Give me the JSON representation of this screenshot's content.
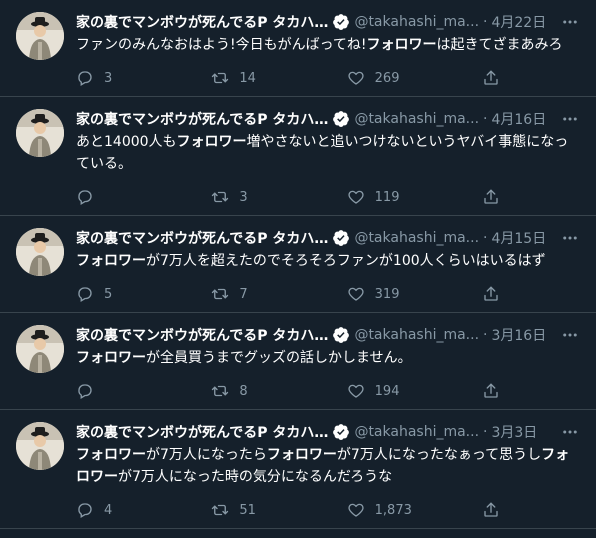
{
  "tweets": [
    {
      "name": "家の裏でマンボウが死んでるP タカハ…",
      "handle": "@takahashi_ma...",
      "date": "4月22日",
      "text_segments": [
        {
          "t": "ファンのみんなおはよう!今日もがんばってね!",
          "b": false
        },
        {
          "t": "フォロワー",
          "b": true
        },
        {
          "t": "は起きてざまあみろ",
          "b": false
        }
      ],
      "replies": "3",
      "retweets": "14",
      "likes": "269"
    },
    {
      "name": "家の裏でマンボウが死んでるP タカハ…",
      "handle": "@takahashi_ma...",
      "date": "4月16日",
      "text_segments": [
        {
          "t": "あと14000人も",
          "b": false
        },
        {
          "t": "フォロワー",
          "b": true
        },
        {
          "t": "増やさないと追いつけないというヤバイ事態になっている。",
          "b": false
        }
      ],
      "replies": "",
      "retweets": "3",
      "likes": "119"
    },
    {
      "name": "家の裏でマンボウが死んでるP タカハ…",
      "handle": "@takahashi_ma...",
      "date": "4月15日",
      "text_segments": [
        {
          "t": "フォロワー",
          "b": true
        },
        {
          "t": "が7万人を超えたのでそろそろファンが100人くらいはいるはず",
          "b": false
        }
      ],
      "replies": "5",
      "retweets": "7",
      "likes": "319"
    },
    {
      "name": "家の裏でマンボウが死んでるP タカハ…",
      "handle": "@takahashi_ma...",
      "date": "3月16日",
      "text_segments": [
        {
          "t": "フォロワー",
          "b": true
        },
        {
          "t": "が全員買うまでグッズの話しかしません。",
          "b": false
        }
      ],
      "replies": "",
      "retweets": "8",
      "likes": "194"
    },
    {
      "name": "家の裏でマンボウが死んでるP タカハ…",
      "handle": "@takahashi_ma...",
      "date": "3月3日",
      "text_segments": [
        {
          "t": "フォロワー",
          "b": true
        },
        {
          "t": "が7万人になったら",
          "b": false
        },
        {
          "t": "フォロワー",
          "b": true
        },
        {
          "t": "が7万人になったなぁって思うし",
          "b": false
        },
        {
          "t": "フォロワー",
          "b": true
        },
        {
          "t": "が7万人になった時の気分になるんだろうな",
          "b": false
        }
      ],
      "replies": "4",
      "retweets": "51",
      "likes": "1,873"
    }
  ],
  "colors": {
    "background": "#15202b",
    "border": "#38444d",
    "muted": "#8899a6",
    "verified_badge": "#ffffff"
  },
  "icons": {
    "reply": "reply-icon",
    "retweet": "retweet-icon",
    "like": "heart-icon",
    "share": "share-icon",
    "verified": "verified-badge-icon",
    "more": "more-icon"
  }
}
